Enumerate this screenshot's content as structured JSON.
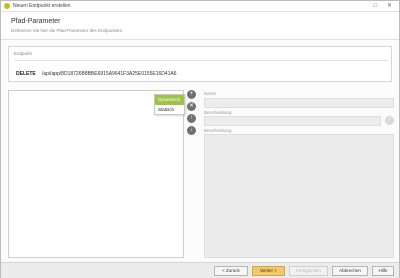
{
  "window": {
    "title": "Neuen Endpunkt erstellen",
    "controls": "□ ✕"
  },
  "header": {
    "title": "Pfad-Parameter",
    "subtitle": "Definieren Sie hier die Pfad-Parameter des Endpunktes."
  },
  "endpoint": {
    "label": "Endpoint",
    "method": "DELETE",
    "path": "/api/app/8D18726B8BBE6915A9641F3A25E0155E16D41A6"
  },
  "menu": {
    "items": [
      "Dynamisch",
      "Statisch"
    ]
  },
  "side_buttons": {
    "add": "+",
    "remove": "✕",
    "up": "↑",
    "down": "↓"
  },
  "form": {
    "name_label": "Name",
    "pattern_label": "Beschreibung",
    "description_label": "Beschreibung",
    "check": "✓"
  },
  "footer": {
    "back": "< Zurück",
    "next": "Weiter >",
    "finish": "Fertigstellen",
    "cancel": "Abbrechen",
    "help": "Hilfe"
  },
  "colors": {
    "primary_button": "#f2c96a",
    "menu_active": "#9fc24a"
  }
}
